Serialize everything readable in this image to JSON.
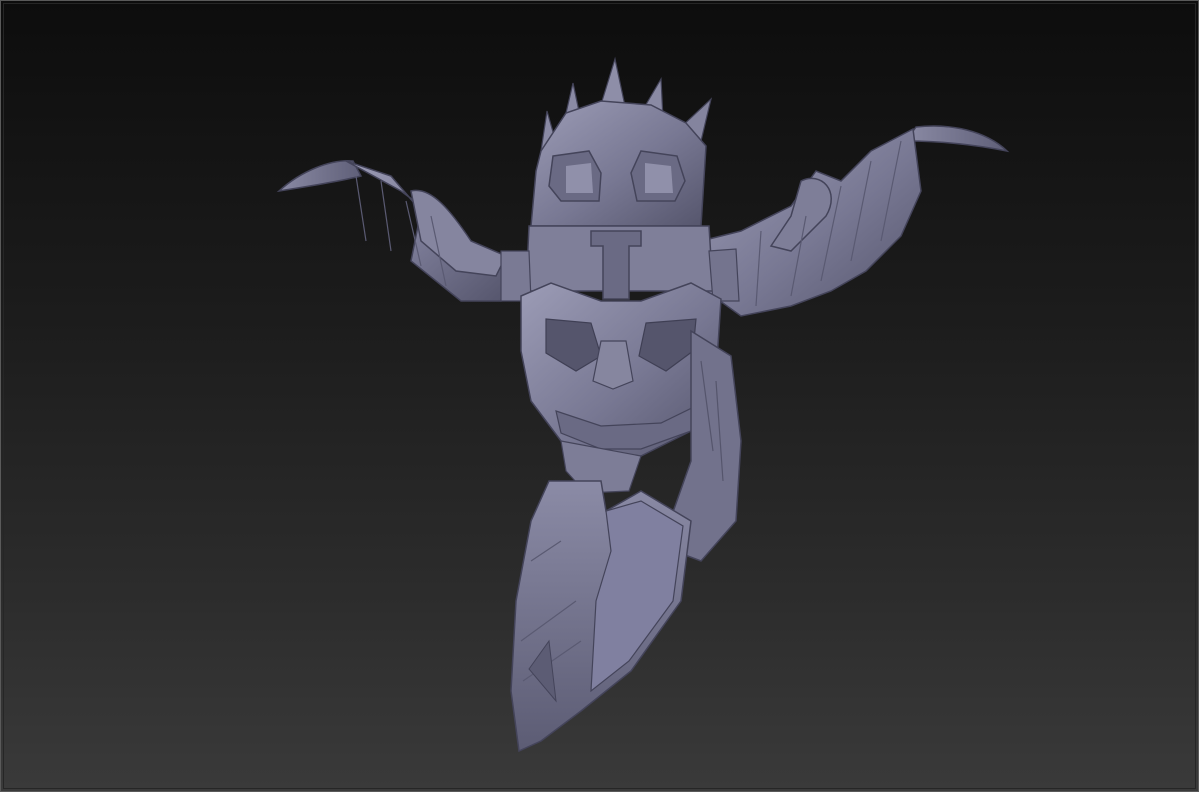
{
  "viewport": {
    "background_top": "#0d0d0d",
    "background_bottom": "#3a3a3a",
    "border_color": "#5a5a5a"
  },
  "model": {
    "subject": "sculpted-wooden-totem-mask",
    "material_color": "#7a7a95",
    "shadow_color": "#4e4e66",
    "highlight_color": "#a6a6c0"
  }
}
